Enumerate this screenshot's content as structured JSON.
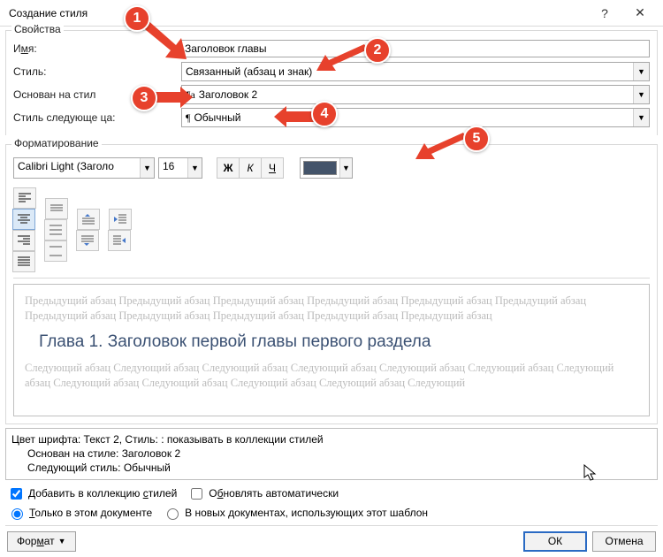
{
  "title": "Создание стиля",
  "titlebar": {
    "help": "?",
    "close": "✕"
  },
  "properties": {
    "legend": "Свойства",
    "name_label_pre": "И",
    "name_label_u": "м",
    "name_label_post": "я:",
    "name_value": "Заголовок главы",
    "style_label": "Стиль:",
    "style_value": "Связанный (абзац и знак)",
    "based_label_pre": "Основан на стил",
    "based_label_split": "е:",
    "based_value": "Заголовок 2",
    "next_label_pre": "Стиль следующе",
    "next_label_mid": "        ца:",
    "next_value": "Обычный"
  },
  "formatting": {
    "legend": "Форматирование",
    "font": "Calibri Light (Заголо",
    "size": "16",
    "bold": "Ж",
    "italic": "К",
    "under": "Ч",
    "color_hex": "#44546a"
  },
  "preview": {
    "ghost_before": "Предыдущий абзац Предыдущий абзац Предыдущий абзац Предыдущий абзац Предыдущий абзац Предыдущий абзац Предыдущий абзац Предыдущий абзац Предыдущий абзац Предыдущий абзац Предыдущий абзац",
    "heading": "Глава 1. Заголовок первой главы первого раздела",
    "ghost_after": "Следующий абзац Следующий абзац Следующий абзац Следующий абзац Следующий абзац Следующий абзац Следующий абзац Следующий абзац Следующий абзац Следующий абзац Следующий абзац Следующий"
  },
  "desc": {
    "line1": "Цвет шрифта: Текст 2, Стиль: : показывать в коллекции стилей",
    "line2": "Основан на стиле: Заголовок 2",
    "line3": "Следующий стиль: Обычный"
  },
  "options": {
    "add_collection_pre": "Добавить в коллекцию ",
    "add_collection_u": "с",
    "add_collection_post": "тилей",
    "auto_update_pre": "О",
    "auto_update_u": "б",
    "auto_update_post": "новлять автоматически",
    "only_doc_u": "Т",
    "only_doc_post": "олько в этом документе",
    "new_docs": "В новых документах, использующих этот шаблон"
  },
  "buttons": {
    "format_pre": "Фор",
    "format_u": "м",
    "format_post": "ат",
    "ok": "ОК",
    "cancel": "Отмена"
  },
  "callouts": {
    "c1": "1",
    "c2": "2",
    "c3": "3",
    "c4": "4",
    "c5": "5"
  }
}
